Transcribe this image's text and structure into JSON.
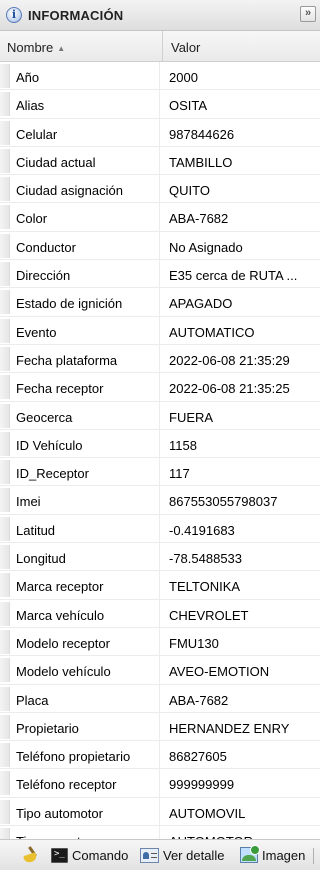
{
  "panel": {
    "title": "INFORMACIÓN",
    "collapse_symbol": "»",
    "info_symbol": "i"
  },
  "columns": {
    "name": "Nombre",
    "value": "Valor",
    "sort_symbol": "▲"
  },
  "rows": [
    {
      "name": "Año",
      "value": "2000"
    },
    {
      "name": "Alias",
      "value": "OSITA"
    },
    {
      "name": "Celular",
      "value": "987844626"
    },
    {
      "name": "Ciudad actual",
      "value": "TAMBILLO"
    },
    {
      "name": "Ciudad asignación",
      "value": "QUITO"
    },
    {
      "name": "Color",
      "value": "ABA-7682"
    },
    {
      "name": "Conductor",
      "value": "No Asignado"
    },
    {
      "name": "Dirección",
      "value": "E35 cerca de RUTA ..."
    },
    {
      "name": "Estado de ignición",
      "value": "APAGADO"
    },
    {
      "name": "Evento",
      "value": "AUTOMATICO"
    },
    {
      "name": "Fecha plataforma",
      "value": "2022-06-08 21:35:29"
    },
    {
      "name": "Fecha receptor",
      "value": "2022-06-08 21:35:25"
    },
    {
      "name": "Geocerca",
      "value": "FUERA"
    },
    {
      "name": "ID Vehículo",
      "value": "1158"
    },
    {
      "name": "ID_Receptor",
      "value": "117"
    },
    {
      "name": "Imei",
      "value": "867553055798037"
    },
    {
      "name": "Latitud",
      "value": "-0.4191683"
    },
    {
      "name": "Longitud",
      "value": "-78.5488533"
    },
    {
      "name": "Marca receptor",
      "value": "TELTONIKA"
    },
    {
      "name": "Marca vehículo",
      "value": "CHEVROLET"
    },
    {
      "name": "Modelo receptor",
      "value": "FMU130"
    },
    {
      "name": "Modelo vehículo",
      "value": "AVEO-EMOTION"
    },
    {
      "name": "Placa",
      "value": "ABA-7682"
    },
    {
      "name": "Propietario",
      "value": "HERNANDEZ ENRY"
    },
    {
      "name": "Teléfono propietario",
      "value": "86827605"
    },
    {
      "name": "Teléfono receptor",
      "value": "999999999"
    },
    {
      "name": "Tipo automotor",
      "value": "AUTOMOVIL"
    },
    {
      "name": "Tipo receptor",
      "value": "AUTOMOTOR"
    }
  ],
  "toolbar": {
    "clear_icon": "broom-icon",
    "command_label": "Comando",
    "detail_label": "Ver detalle",
    "image_label": "Imagen"
  }
}
